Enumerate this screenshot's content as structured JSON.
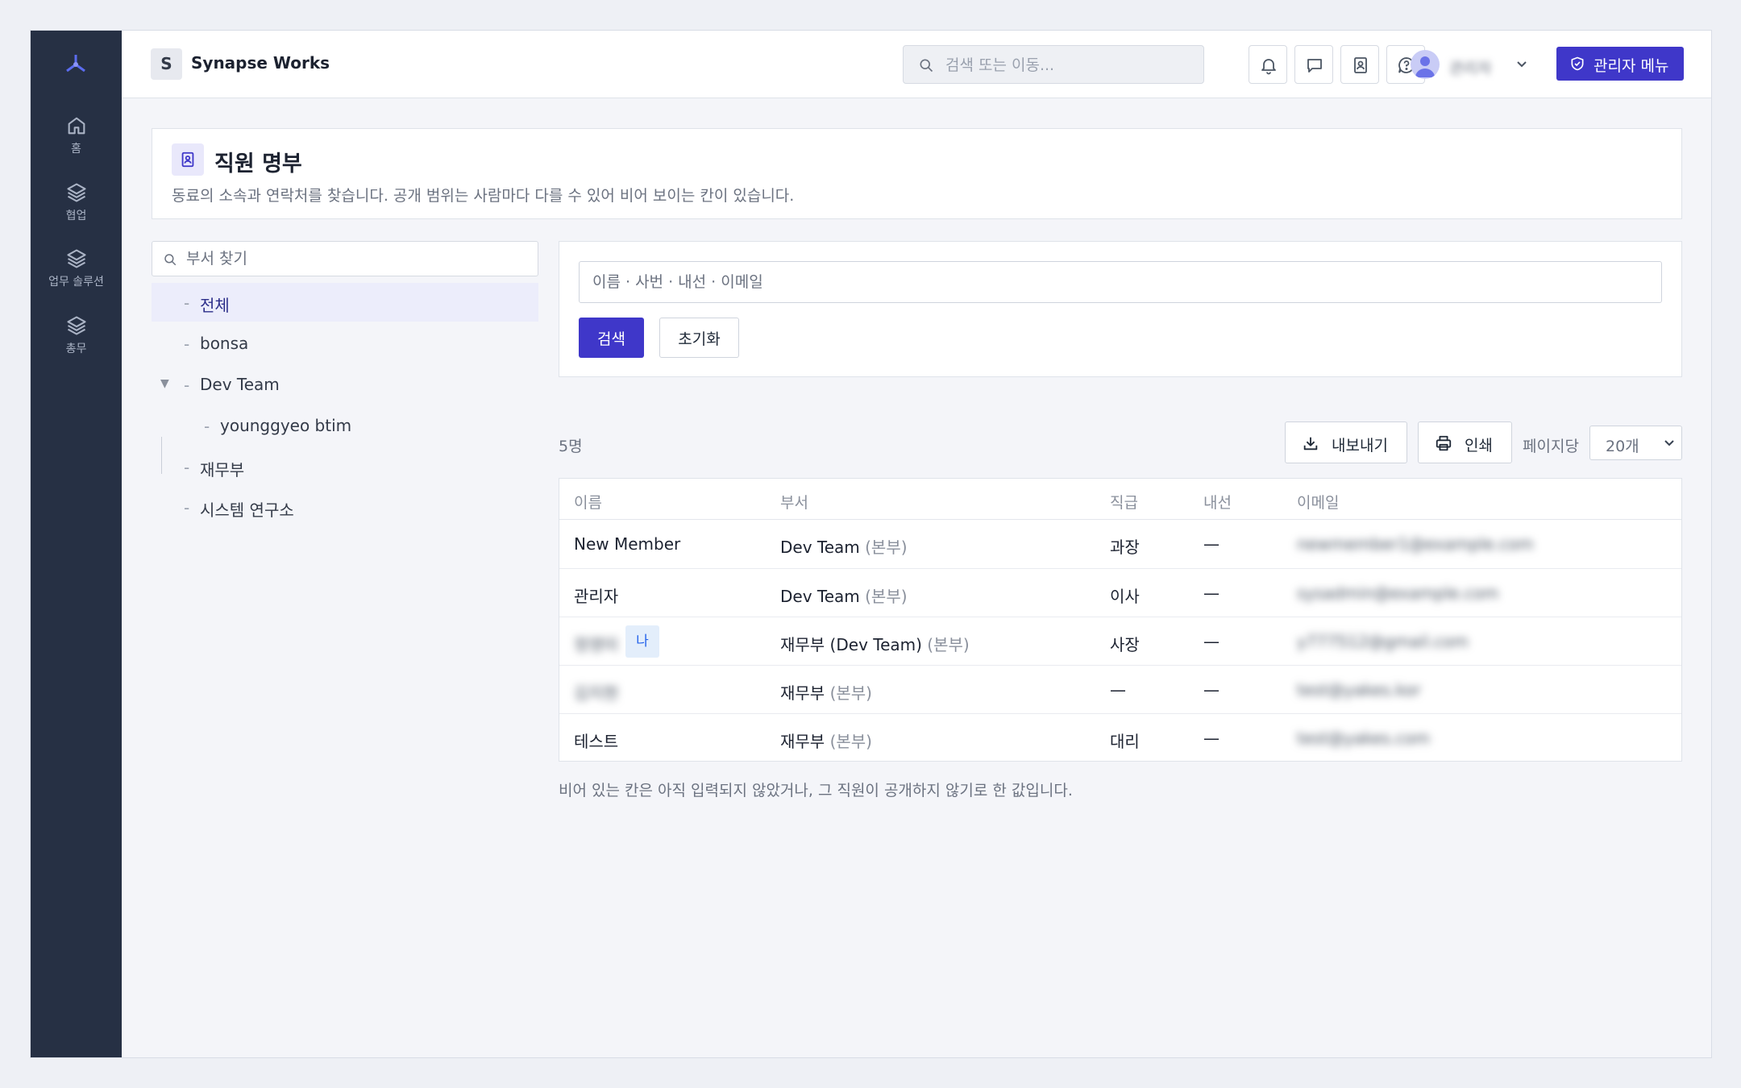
{
  "workspace": {
    "badge": "S",
    "name": "Synapse Works"
  },
  "rail": {
    "items": [
      {
        "label": "홈",
        "icon": "home-icon"
      },
      {
        "label": "협업",
        "icon": "layers-icon"
      },
      {
        "label": "업무 솔루션",
        "icon": "layers-icon"
      },
      {
        "label": "총무",
        "icon": "layers-icon"
      }
    ]
  },
  "topbar": {
    "search_placeholder": "검색 또는 이동...",
    "icons": [
      "bell-icon",
      "chat-icon",
      "contact-book-icon",
      "help-icon"
    ],
    "user_name": "관리자",
    "admin_button": "관리자 메뉴"
  },
  "page": {
    "title": "직원 명부",
    "subtitle": "동료의 소속과 연락처를 찾습니다. 공개 범위는 사람마다 다를 수 있어 비어 보이는 칸이 있습니다."
  },
  "dept_tree": {
    "search_placeholder": "부서 찾기",
    "items": [
      {
        "label": "전체",
        "active": true
      },
      {
        "label": "bonsa"
      },
      {
        "label": "Dev Team",
        "expanded": true
      },
      {
        "label": "younggyeo btim",
        "child": true
      },
      {
        "label": "재무부"
      },
      {
        "label": "시스템 연구소"
      }
    ]
  },
  "search_form": {
    "placeholder": "이름 · 사번 · 내선 · 이메일",
    "search_button": "검색",
    "reset_button": "초기화"
  },
  "results": {
    "count": "5명",
    "export_button": "내보내기",
    "print_button": "인쇄",
    "per_page_label": "페이지당",
    "per_page_value": "20개"
  },
  "table": {
    "headers": {
      "name": "이름",
      "dept": "부서",
      "rank": "직급",
      "ext": "내선",
      "email": "이메일"
    },
    "rows": [
      {
        "name": "New Member",
        "dept": "Dev Team",
        "dept_hint": "(본부)",
        "rank": "과장",
        "ext": "—",
        "email": "newmember1@example.com",
        "blurred_name": false
      },
      {
        "name": "관리자",
        "dept": "Dev Team",
        "dept_hint": "(본부)",
        "rank": "이사",
        "ext": "—",
        "email": "sysadmin@example.com",
        "blurred_name": false
      },
      {
        "name": "정영미",
        "me_badge": "나",
        "dept": "재무부 (Dev Team)",
        "dept_hint": "(본부)",
        "rank": "사장",
        "ext": "—",
        "email": "y777512@gmail.com",
        "blurred_name": true
      },
      {
        "name": "김지현",
        "dept": "재무부",
        "dept_hint": "(본부)",
        "rank": "—",
        "ext": "—",
        "email": "test@yakes.kor",
        "blurred_name": true
      },
      {
        "name": "테스트",
        "dept": "재무부",
        "dept_hint": "(본부)",
        "rank": "대리",
        "ext": "—",
        "email": "test@yakes.com",
        "blurred_name": false
      }
    ]
  },
  "footnote": "비어 있는 칸은 아직 입력되지 않았거나, 그 직원이 공개하지 않기로 한 값입니다.",
  "colors": {
    "accent": "#3f37c9",
    "rail": "#263044",
    "active_tree": "#ecedfb",
    "me_badge": "#e3eefb"
  }
}
